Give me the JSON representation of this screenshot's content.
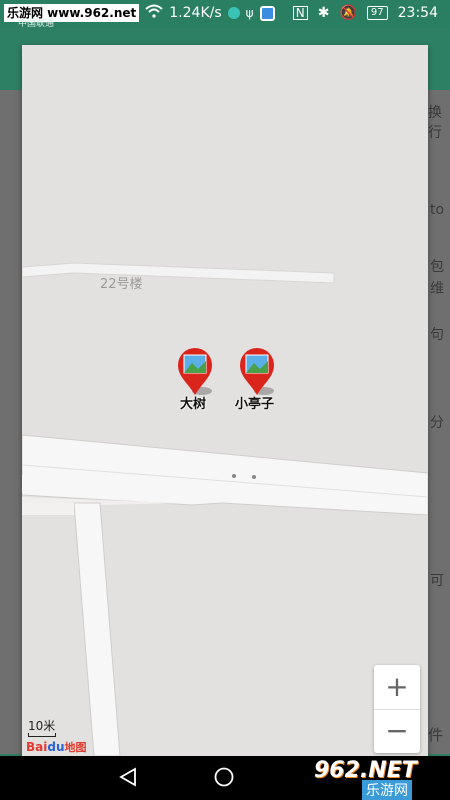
{
  "status_bar": {
    "site": "乐游网 www.962.net",
    "carrier": "中国联通",
    "speed": "1.24K/s",
    "battery": "97",
    "time": "23:54"
  },
  "background": {
    "right_snippets": [
      "换行",
      "to",
      "包",
      "维",
      "句",
      "分",
      "可",
      "件"
    ]
  },
  "map": {
    "poi_label": "22号楼",
    "markers": [
      {
        "label": "大树"
      },
      {
        "label": "小亭子"
      }
    ],
    "zoom_in": "+",
    "zoom_out": "−",
    "scale_text": "10米",
    "logo": {
      "bai": "Bai",
      "du": "du",
      "ditu": "地图"
    }
  },
  "watermark": {
    "top": "962.NET",
    "bottom": "乐游网"
  },
  "colors": {
    "status_bar": "#2a7f62",
    "marker_red": "#d9251b",
    "map_bg": "#e3e1df",
    "road": "#f7f7f7"
  }
}
